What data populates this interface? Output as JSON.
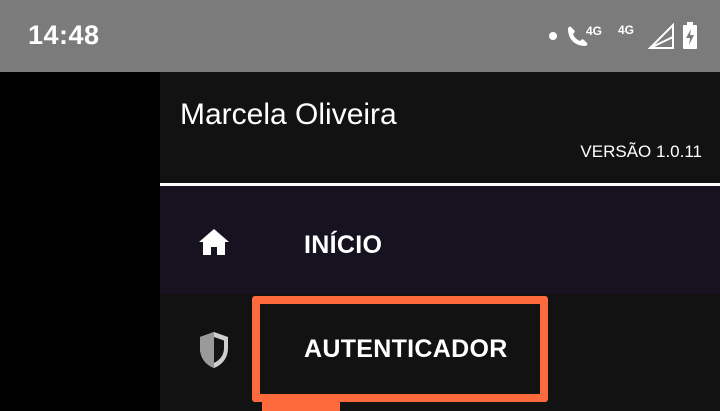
{
  "status_bar": {
    "time": "14:48",
    "network_labels": [
      "4G",
      "4G"
    ],
    "icons": [
      "notification-dot-icon",
      "volte-call-icon",
      "signal-icon",
      "battery-charging-icon"
    ]
  },
  "drawer": {
    "user_name": "Marcela Oliveira",
    "version": "VERSÃO 1.0.11",
    "items": [
      {
        "label": "INÍCIO",
        "icon": "home-icon",
        "selected": true
      },
      {
        "label": "AUTENTICADOR",
        "icon": "shield-icon",
        "selected": false
      }
    ]
  },
  "colors": {
    "status_bar_bg": "#7b7b7b",
    "drawer_bg": "#141414",
    "selected_item_bg": "#16121f",
    "highlight_annotation": "#ff6a3d"
  }
}
